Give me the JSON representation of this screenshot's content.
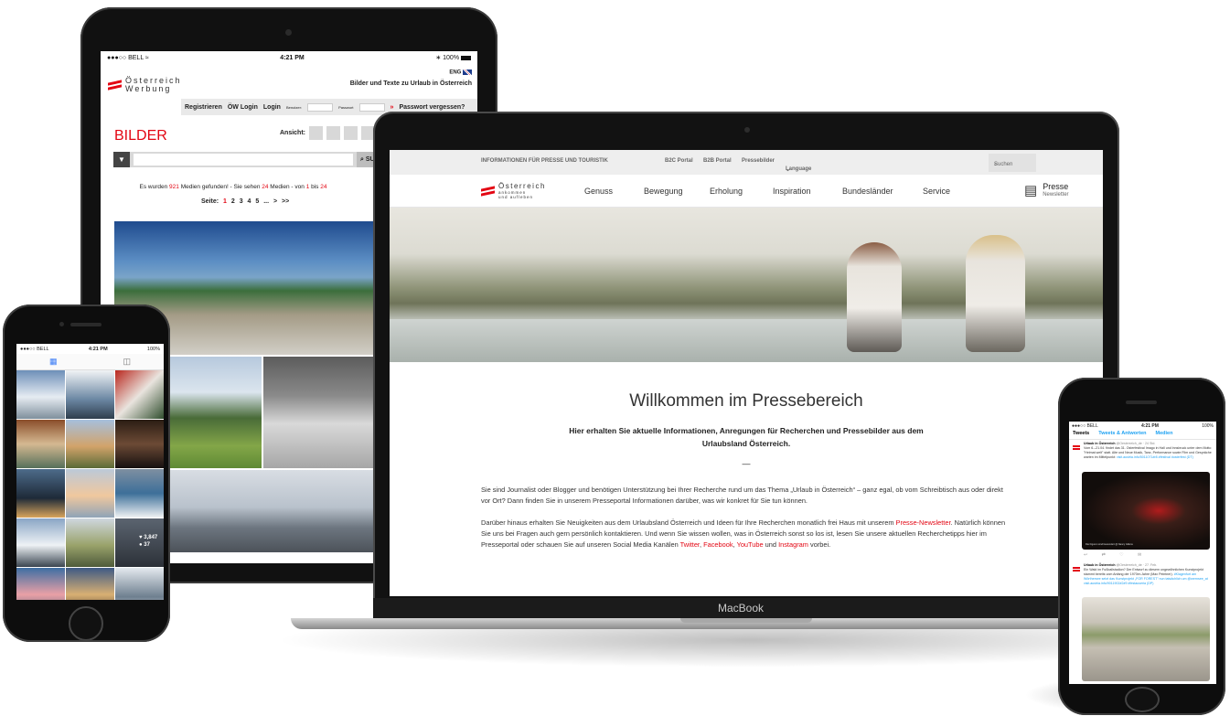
{
  "colors": {
    "accent_red": "#e30613",
    "twitter_blue": "#1da1f2",
    "ios_blue": "#3b7cf6",
    "device_black": "#111111"
  },
  "tablet": {
    "status": {
      "carrier": "●●●○○ BELL",
      "wifi": "wifi-icon",
      "time": "4:21 PM",
      "battery": "100%"
    },
    "logo_line1": "Österreich",
    "logo_line2": "Werbung",
    "lang": "ENG",
    "slogan": "Bilder und Texte zu Urlaub in Österreich",
    "login": {
      "register": "Registrieren",
      "ow_login": "ÖW Login",
      "login": "Login",
      "user_label": "Benutzer:",
      "pass_label": "Passwort",
      "arrow": "»",
      "forgot": "Passwort vergessen?"
    },
    "section_title": "BILDER",
    "ansicht_label": "Ansicht:",
    "search_button": "SUC",
    "result": {
      "prefix": "Es wurden",
      "total": "921",
      "mid": "Medien gefunden! - Sie sehen",
      "shown": "24",
      "mid2": "Medien - von",
      "from": "1",
      "mid3": "bis",
      "to": "24"
    },
    "pages": {
      "label": "Seite:",
      "current": "1",
      "rest": "2 3 4 5 ... > >>"
    }
  },
  "laptop": {
    "topbar": {
      "info": "INFORMATIONEN FÜR PRESSE UND TOURISTIK",
      "b2c": "B2C Portal",
      "b2b": "B2B Portal",
      "pressebilder": "Pressebilder",
      "language": "Language",
      "search_placeholder": "Suchen"
    },
    "logo_line1": "Österreich",
    "logo_line2": "ankommen",
    "logo_line3": "und aufleben",
    "nav": [
      "Genuss",
      "Bewegung",
      "Erholung",
      "Inspiration",
      "Bundesländer",
      "Service"
    ],
    "press_title": "Presse",
    "press_sub": "Newsletter",
    "title": "Willkommen im Pressebereich",
    "subtitle": "Hier erhalten Sie aktuelle Informationen, Anregungen für Recherchen und Pressebilder aus dem Urlaubsland Österreich.",
    "dash": "—",
    "para1": "Sie sind Journalist oder Blogger und benötigen Unterstützung bei Ihrer Recherche rund um das Thema „Urlaub in Österreich“ – ganz egal, ob vom Schreibtisch aus oder direkt vor Ort? Dann finden Sie in unserem Presseportal Informationen darüber, was wir konkret für Sie tun können.",
    "para2_a": "Darüber hinaus erhalten Sie Neuigkeiten aus dem Urlaubsland Österreich und Ideen für Ihre Recherchen monatlich frei Haus mit unserem",
    "para2_link1": "Presse-Newsletter",
    "para2_b": ". Natürlich können Sie uns bei Fragen auch gern persönlich kontaktieren. Und wenn Sie wissen wollen, was in Österreich sonst so los ist, lesen Sie unsere aktuellen Recherchetipps hier im Presseportal oder schauen Sie auf unseren Social Media Kanälen",
    "para2_twitter": "Twitter",
    "para2_comma": ",",
    "para2_facebook": "Facebook",
    "para2_comma2": ",",
    "para2_youtube": "YouTube",
    "para2_und": "und",
    "para2_instagram": "Instagram",
    "para2_end": "vorbei.",
    "brand": "MacBook"
  },
  "phone_left": {
    "status": {
      "carrier": "●●●○○ BELL",
      "time": "4:21 PM",
      "battery": "100%"
    },
    "tabs": [
      "grid-icon",
      "camera-icon"
    ],
    "overlay_likes": "♥ 3,847",
    "overlay_comments": "● 37"
  },
  "phone_right": {
    "status": {
      "carrier": "●●●○○ BELL",
      "time": "4:21 PM",
      "battery": "100%"
    },
    "tabs": [
      "Tweets",
      "Tweets & Antworten",
      "Medien"
    ],
    "tweet1": {
      "name": "Urlaub in Österreich",
      "handle": "@Oesterreich_de · 24 Std.",
      "text": "Vom 6.–21.04. findet das 31. Osterfestival Imago in Hall und Innsbruck unter dem Motto \"Heimat.welt\" statt. Alte und Neue Musik, Tanz, Performance sowie Film und Gespräche warten im Mittelpunkt:",
      "link": "visit.austria.info/5011071#r8 #festival #osterfest (DT)",
      "caption": "Die Figuren sind bewundert @ Nancy Gillens",
      "icons": "↩ ⇄ ♡ ✉"
    },
    "tweet2": {
      "name": "Urlaub in Österreich",
      "handle": "@Oesterreich_de · 27. Feb.",
      "text": "Ein Wald im Fußballstadion? Der Entwurf zu diesem ungewöhnlichen Kunstprojekt stammt bereits vom Anfang der 1970er-Jahre (Max Peintner).",
      "link": "#Klagenfurt am Wörthersee setzt das Kunstprojekt „FOR FOREST\" nun tatsächlich um @wernsee_at visit.austria.info/9011902#2#9 #festauseria (DP)"
    }
  }
}
